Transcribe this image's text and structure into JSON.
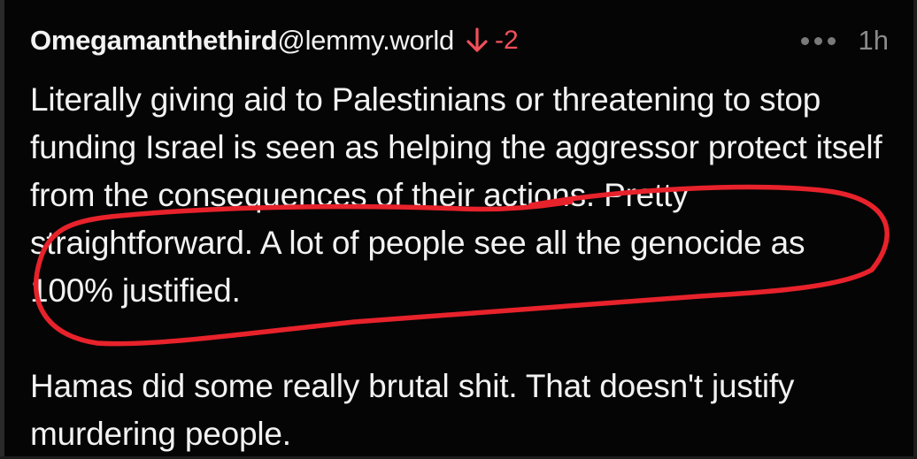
{
  "comment": {
    "author": {
      "name": "Omegamanthethird",
      "instance": "@lemmy.world"
    },
    "vote": {
      "icon": "arrow-down-icon",
      "score": "-2",
      "color": "#f0505a"
    },
    "menu_icon": "more-dots-icon",
    "timestamp": "1h",
    "paragraphs": [
      "Literally giving aid to Palestinians or threatening to stop funding Israel is seen as helping the aggressor protect itself from the consequences of their actions. Pretty straightforward. A lot of people see all the genocide as 100% justified.",
      "Hamas did some really brutal shit. That doesn't justify murdering people."
    ]
  },
  "annotation": {
    "type": "red freehand loop",
    "color": "#e8222b"
  },
  "colors": {
    "background": "#050505",
    "text": "#f2f2f2",
    "muted": "#8a8a8a"
  }
}
